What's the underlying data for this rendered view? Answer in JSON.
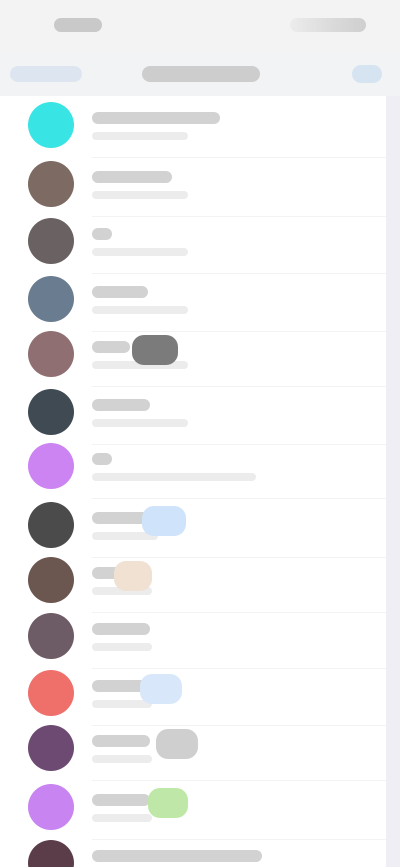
{
  "colors": {
    "status_bar": "#f3f3f3",
    "nav_bar": "#f2f3f5",
    "list_background": "#ffffff",
    "side_strip": "#eeeef4"
  },
  "rows": [
    {
      "avatar_color": "#38e4e4",
      "tag_color": null
    },
    {
      "avatar_color": "#7d6a62",
      "tag_color": null
    },
    {
      "avatar_color": "#6a6262",
      "tag_color": null
    },
    {
      "avatar_color": "#6a7c90",
      "tag_color": null
    },
    {
      "avatar_color": "#8f6f72",
      "tag_color": "#7b7b7b"
    },
    {
      "avatar_color": "#3f4a52",
      "tag_color": null
    },
    {
      "avatar_color": "#cc84f2",
      "tag_color": null
    },
    {
      "avatar_color": "#4b4b4b",
      "tag_color": "#cfe3fa"
    },
    {
      "avatar_color": "#6b5650",
      "tag_color": "#f1e1d2"
    },
    {
      "avatar_color": "#6d5b66",
      "tag_color": null
    },
    {
      "avatar_color": "#ef6f6a",
      "tag_color": "#d8e8fa"
    },
    {
      "avatar_color": "#6d4a72",
      "tag_color": "#cfcfcf"
    },
    {
      "avatar_color": "#c884f0",
      "tag_color": "#bfe8a8"
    },
    {
      "avatar_color": "#5b3d4a",
      "tag_color": null
    }
  ]
}
